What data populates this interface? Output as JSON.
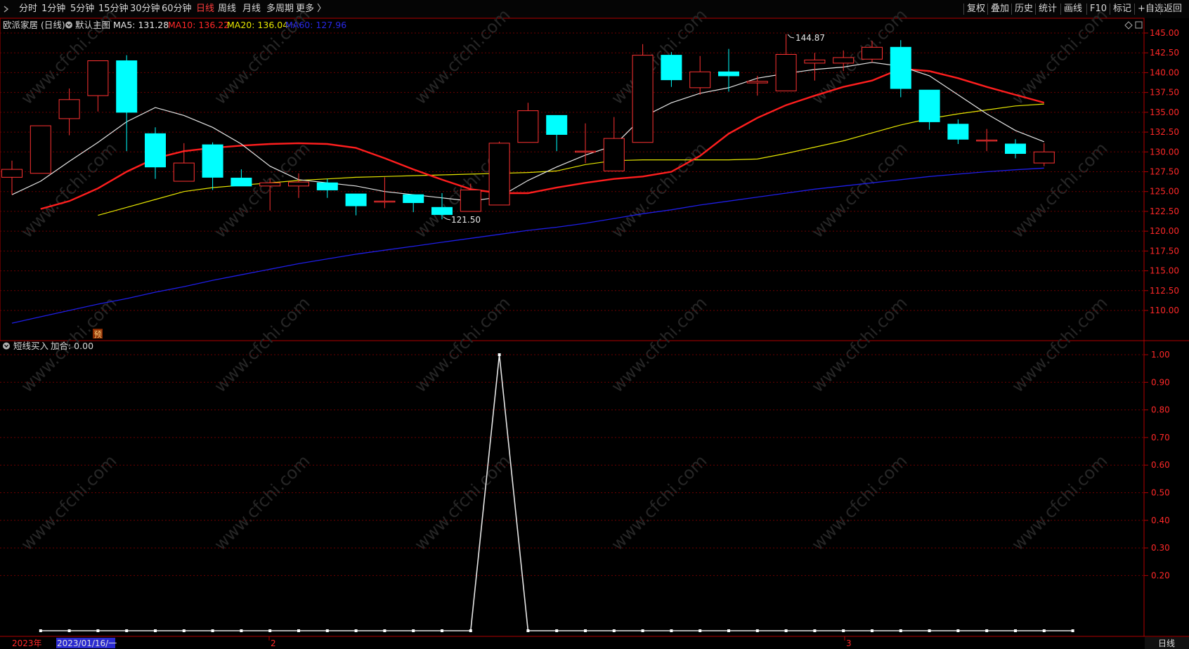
{
  "toolbar": {
    "periods": [
      {
        "label": "分时",
        "active": false
      },
      {
        "label": "1分钟",
        "active": false
      },
      {
        "label": "5分钟",
        "active": false
      },
      {
        "label": "15分钟",
        "active": false
      },
      {
        "label": "30分钟",
        "active": false
      },
      {
        "label": "60分钟",
        "active": false
      },
      {
        "label": "日线",
        "active": true
      },
      {
        "label": "周线",
        "active": false
      },
      {
        "label": "月线",
        "active": false
      },
      {
        "label": "多周期",
        "active": false
      },
      {
        "label": "更多 〉",
        "active": false
      }
    ],
    "actions": [
      "复权",
      "叠加",
      "历史",
      "统计",
      "画线",
      "F10",
      "标记",
      "+自选",
      "返回"
    ]
  },
  "main_panel": {
    "stock_title": "欧派家居 (日线)",
    "indicator_name": "默认主图",
    "ma5": "MA5: 131.28",
    "ma10": "MA10: 136.22",
    "ma20": "MA20: 136.04",
    "ma60": "MA60: 127.96",
    "high_label": "144.87",
    "low_label": "121.50",
    "marker_label": "预"
  },
  "sub_panel": {
    "title": "短线买入",
    "value_text": "加合: 0.00"
  },
  "date_axis": {
    "year_label": "2023年",
    "cursor_date": "2023/01/16/一",
    "month_labels": [
      "2",
      "3"
    ]
  },
  "period_badge": "日线",
  "watermark": "www.cfchi.com",
  "colors": {
    "up": "#ff3232",
    "down": "#00ffff",
    "ma5": "#e6e6e6",
    "ma10": "#ff1e1e",
    "ma20": "#e6e600",
    "ma60": "#1e1ee6",
    "grid": "#6e0000",
    "axis": "#b40000"
  },
  "chart_data": [
    {
      "type": "candlestick",
      "title": "欧派家居 (日线)",
      "y_ticks": [
        "145.00",
        "142.50",
        "140.00",
        "137.50",
        "135.00",
        "132.50",
        "130.00",
        "127.50",
        "125.00",
        "122.50",
        "120.00",
        "117.50",
        "115.00",
        "112.50",
        "110.00"
      ],
      "ylim": [
        106,
        146
      ],
      "candles": [
        {
          "open": 126.8,
          "close": 127.8,
          "high": 128.9,
          "low": 124.6
        },
        {
          "open": 127.3,
          "close": 133.3,
          "high": 133.3,
          "low": 127.3
        },
        {
          "open": 134.2,
          "close": 136.6,
          "high": 138.0,
          "low": 132.1
        },
        {
          "open": 137.1,
          "close": 141.5,
          "high": 141.5,
          "low": 135.1
        },
        {
          "open": 141.5,
          "close": 135.0,
          "high": 142.2,
          "low": 130.1
        },
        {
          "open": 132.3,
          "close": 128.1,
          "high": 133.1,
          "low": 126.6
        },
        {
          "open": 126.3,
          "close": 128.6,
          "high": 131.1,
          "low": 126.3
        },
        {
          "open": 130.9,
          "close": 126.8,
          "high": 131.2,
          "low": 125.2
        },
        {
          "open": 126.7,
          "close": 125.7,
          "high": 127.8,
          "low": 125.7
        },
        {
          "open": 125.7,
          "close": 126.1,
          "high": 126.6,
          "low": 122.6
        },
        {
          "open": 125.7,
          "close": 126.2,
          "high": 127.3,
          "low": 124.2
        },
        {
          "open": 126.1,
          "close": 125.2,
          "high": 126.6,
          "low": 124.2
        },
        {
          "open": 124.7,
          "close": 123.2,
          "high": 124.7,
          "low": 122.0
        },
        {
          "open": 123.8,
          "close": 123.8,
          "high": 126.8,
          "low": 122.9
        },
        {
          "open": 124.6,
          "close": 123.6,
          "high": 124.6,
          "low": 122.4
        },
        {
          "open": 123.0,
          "close": 122.1,
          "high": 124.8,
          "low": 121.5
        },
        {
          "open": 122.5,
          "close": 125.2,
          "high": 126.0,
          "low": 122.5
        },
        {
          "open": 123.3,
          "close": 131.1,
          "high": 131.3,
          "low": 123.3
        },
        {
          "open": 131.2,
          "close": 135.2,
          "high": 136.2,
          "low": 131.2
        },
        {
          "open": 134.6,
          "close": 132.2,
          "high": 134.6,
          "low": 130.1
        },
        {
          "open": 130.1,
          "close": 130.1,
          "high": 133.6,
          "low": 128.6
        },
        {
          "open": 127.6,
          "close": 131.7,
          "high": 134.4,
          "low": 127.6
        },
        {
          "open": 131.2,
          "close": 142.2,
          "high": 143.6,
          "low": 131.2
        },
        {
          "open": 142.2,
          "close": 139.1,
          "high": 142.6,
          "low": 138.2
        },
        {
          "open": 138.1,
          "close": 140.1,
          "high": 142.1,
          "low": 137.2
        },
        {
          "open": 140.1,
          "close": 139.6,
          "high": 143.0,
          "low": 137.6
        },
        {
          "open": 138.7,
          "close": 138.9,
          "high": 139.6,
          "low": 137.1
        },
        {
          "open": 137.7,
          "close": 142.3,
          "high": 144.87,
          "low": 137.7
        },
        {
          "open": 141.2,
          "close": 141.6,
          "high": 142.5,
          "low": 139.0
        },
        {
          "open": 141.2,
          "close": 141.9,
          "high": 142.8,
          "low": 140.2
        },
        {
          "open": 141.7,
          "close": 143.2,
          "high": 144.0,
          "low": 141.3
        },
        {
          "open": 143.2,
          "close": 138.0,
          "high": 144.1,
          "low": 136.9
        },
        {
          "open": 137.8,
          "close": 133.8,
          "high": 137.8,
          "low": 132.8
        },
        {
          "open": 133.5,
          "close": 131.6,
          "high": 134.1,
          "low": 131.0
        },
        {
          "open": 131.5,
          "close": 131.5,
          "high": 132.9,
          "low": 130.1
        },
        {
          "open": 131.0,
          "close": 129.8,
          "high": 131.6,
          "low": 129.2
        },
        {
          "open": 128.6,
          "close": 130.0,
          "high": 131.1,
          "low": 128.2
        }
      ],
      "series": [
        {
          "name": "MA5",
          "values": [
            124.6,
            126.3,
            128.8,
            131.2,
            133.8,
            135.6,
            134.6,
            133.1,
            131.0,
            128.2,
            126.5,
            126.1,
            125.7,
            125.0,
            124.6,
            124.2,
            123.8,
            124.3,
            126.4,
            128.1,
            129.6,
            130.8,
            134.4,
            136.2,
            137.4,
            138.1,
            139.3,
            139.9,
            140.4,
            140.7,
            141.3,
            140.8,
            139.6,
            137.2,
            134.8,
            132.7,
            131.28
          ]
        },
        {
          "name": "MA10",
          "values": [
            122.8,
            123.8,
            125.4,
            127.5,
            129.2,
            130.1,
            130.5,
            130.8,
            131.0,
            131.1,
            131.0,
            130.5,
            129.2,
            127.8,
            126.5,
            125.3,
            124.8,
            124.8,
            125.5,
            126.1,
            126.6,
            126.9,
            127.5,
            129.5,
            132.3,
            134.3,
            135.9,
            137.1,
            138.2,
            139.0,
            140.5,
            140.2,
            139.3,
            138.2,
            137.2,
            136.22
          ]
        },
        {
          "name": "MA20",
          "values": [
            122.0,
            123.0,
            124.0,
            125.0,
            125.5,
            125.8,
            126.1,
            126.4,
            126.6,
            126.8,
            126.9,
            127.0,
            127.1,
            127.2,
            127.3,
            127.4,
            127.6,
            128.4,
            128.9,
            129.0,
            129.0,
            129.0,
            129.0,
            129.1,
            129.8,
            130.6,
            131.4,
            132.4,
            133.4,
            134.2,
            134.8,
            135.3,
            135.8,
            136.04
          ]
        },
        {
          "name": "MA60",
          "values": [
            108.4,
            109.2,
            110.0,
            110.8,
            111.5,
            112.3,
            113.0,
            113.8,
            114.5,
            115.2,
            115.9,
            116.5,
            117.1,
            117.6,
            118.1,
            118.6,
            119.1,
            119.6,
            120.1,
            120.5,
            121.0,
            121.6,
            122.2,
            122.7,
            123.3,
            123.8,
            124.3,
            124.8,
            125.3,
            125.7,
            126.1,
            126.5,
            126.9,
            127.2,
            127.5,
            127.75,
            127.96
          ]
        }
      ]
    },
    {
      "type": "line",
      "title": "短线买入",
      "y_ticks": [
        "1.00",
        "0.90",
        "0.80",
        "0.70",
        "0.60",
        "0.50",
        "0.40",
        "0.30",
        "0.20"
      ],
      "ylim": [
        0,
        1
      ],
      "series": [
        {
          "name": "短线买入",
          "values": [
            0,
            0,
            0,
            0,
            0,
            0,
            0,
            0,
            0,
            0,
            0,
            0,
            0,
            0,
            0,
            0,
            1,
            0,
            0,
            0,
            0,
            0,
            0,
            0,
            0,
            0,
            0,
            0,
            0,
            0,
            0,
            0,
            0,
            0,
            0,
            0,
            0
          ]
        }
      ]
    }
  ]
}
